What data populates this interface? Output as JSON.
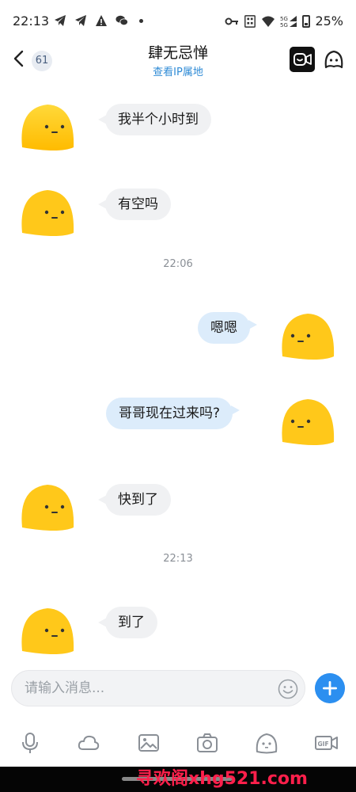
{
  "status_bar": {
    "time": "22:13",
    "signal_label": "5G\n5G",
    "battery": "25%"
  },
  "header": {
    "unread_count": "61",
    "title": "肆无忌惮",
    "subtitle": "查看IP属地"
  },
  "messages": [
    {
      "side": "in",
      "text": "我半个小时到"
    },
    {
      "side": "in",
      "text": "有空吗"
    },
    {
      "side": "time",
      "text": "22:06"
    },
    {
      "side": "out",
      "text": "嗯嗯"
    },
    {
      "side": "out",
      "text": "哥哥现在过来吗?"
    },
    {
      "side": "in",
      "text": "快到了"
    },
    {
      "side": "time",
      "text": "22:13"
    },
    {
      "side": "in",
      "text": "到了"
    }
  ],
  "composer": {
    "placeholder": "请输入消息..."
  },
  "toolbar": {
    "gif_label": "GIF"
  },
  "watermark": "寻欢阁xhg521.com",
  "colors": {
    "accent": "#2c8ff0",
    "incoming_bubble": "#f0f1f3",
    "outgoing_bubble": "#dcecfb",
    "avatar_yellow": "#ffcc1a",
    "watermark": "#ff1f4b"
  }
}
